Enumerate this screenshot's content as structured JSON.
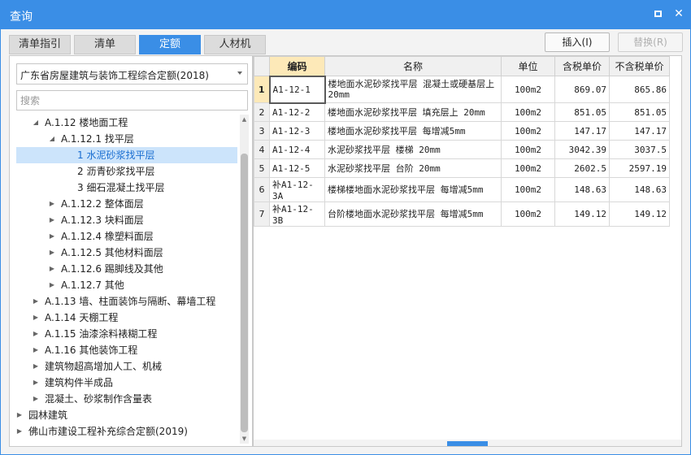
{
  "window": {
    "title": "查询",
    "maximize_icon": "maximize-icon",
    "close_icon": "close-icon",
    "accent": "#3a8ee6"
  },
  "tabs": [
    {
      "label": "清单指引",
      "active": false
    },
    {
      "label": "清单",
      "active": false
    },
    {
      "label": "定额",
      "active": true
    },
    {
      "label": "人材机",
      "active": false
    }
  ],
  "toolbar": {
    "insert_label": "插入(I)",
    "replace_label": "替换(R)"
  },
  "left": {
    "quota_library": "广东省房屋建筑与装饰工程综合定额(2018)",
    "search_placeholder": "搜索",
    "tree": [
      {
        "label": "A.1.12 楼地面工程",
        "level": 1,
        "state": "expanded"
      },
      {
        "label": "A.1.12.1 找平层",
        "level": 2,
        "state": "expanded"
      },
      {
        "label": "1 水泥砂浆找平层",
        "level": 3,
        "state": "leaf",
        "selected": true
      },
      {
        "label": "2 沥青砂浆找平层",
        "level": 3,
        "state": "leaf"
      },
      {
        "label": "3 细石混凝土找平层",
        "level": 3,
        "state": "leaf"
      },
      {
        "label": "A.1.12.2 整体面层",
        "level": 2,
        "state": "collapsed"
      },
      {
        "label": "A.1.12.3 块料面层",
        "level": 2,
        "state": "collapsed"
      },
      {
        "label": "A.1.12.4 橡塑料面层",
        "level": 2,
        "state": "collapsed"
      },
      {
        "label": "A.1.12.5 其他材料面层",
        "level": 2,
        "state": "collapsed"
      },
      {
        "label": "A.1.12.6 踢脚线及其他",
        "level": 2,
        "state": "collapsed"
      },
      {
        "label": "A.1.12.7 其他",
        "level": 2,
        "state": "collapsed"
      },
      {
        "label": "A.1.13 墙、柱面装饰与隔断、幕墙工程",
        "level": 1,
        "state": "collapsed"
      },
      {
        "label": "A.1.14 天棚工程",
        "level": 1,
        "state": "collapsed"
      },
      {
        "label": "A.1.15 油漆涂料裱糊工程",
        "level": 1,
        "state": "collapsed"
      },
      {
        "label": "A.1.16 其他装饰工程",
        "level": 1,
        "state": "collapsed"
      },
      {
        "label": "建筑物超高增加人工、机械",
        "level": 1,
        "state": "collapsed"
      },
      {
        "label": "建筑构件半成品",
        "level": 1,
        "state": "collapsed"
      },
      {
        "label": "混凝土、砂浆制作含量表",
        "level": 1,
        "state": "collapsed"
      },
      {
        "label": "园林建筑",
        "level": 0,
        "state": "collapsed"
      },
      {
        "label": "佛山市建设工程补充综合定额(2019)",
        "level": 0,
        "state": "collapsed"
      }
    ]
  },
  "grid": {
    "columns": [
      "",
      "编码",
      "名称",
      "单位",
      "含税单价",
      "不含税单价"
    ],
    "rows": [
      {
        "idx": "1",
        "code": "A1-12-1",
        "name": "楼地面水泥砂浆找平层 混凝土或硬基层上 20mm",
        "unit": "100m2",
        "price_tax": "869.07",
        "price_notax": "865.86",
        "current": true
      },
      {
        "idx": "2",
        "code": "A1-12-2",
        "name": "楼地面水泥砂浆找平层 填充层上 20mm",
        "unit": "100m2",
        "price_tax": "851.05",
        "price_notax": "851.05"
      },
      {
        "idx": "3",
        "code": "A1-12-3",
        "name": "楼地面水泥砂浆找平层 每增减5mm",
        "unit": "100m2",
        "price_tax": "147.17",
        "price_notax": "147.17"
      },
      {
        "idx": "4",
        "code": "A1-12-4",
        "name": "水泥砂浆找平层 楼梯 20mm",
        "unit": "100m2",
        "price_tax": "3042.39",
        "price_notax": "3037.5"
      },
      {
        "idx": "5",
        "code": "A1-12-5",
        "name": "水泥砂浆找平层 台阶 20mm",
        "unit": "100m2",
        "price_tax": "2602.5",
        "price_notax": "2597.19"
      },
      {
        "idx": "6",
        "code": "补A1-12-3A",
        "name": "楼梯楼地面水泥砂浆找平层 每增减5mm",
        "unit": "100m2",
        "price_tax": "148.63",
        "price_notax": "148.63"
      },
      {
        "idx": "7",
        "code": "补A1-12-3B",
        "name": "台阶楼地面水泥砂浆找平层 每增减5mm",
        "unit": "100m2",
        "price_tax": "149.12",
        "price_notax": "149.12"
      }
    ]
  }
}
